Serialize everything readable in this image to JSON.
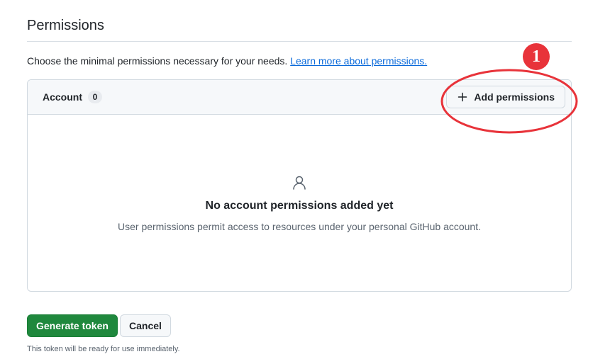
{
  "section": {
    "title": "Permissions",
    "intro_text": "Choose the minimal permissions necessary for your needs.",
    "learn_more_link": "Learn more about permissions."
  },
  "account_panel": {
    "heading": "Account",
    "count": "0",
    "add_button_label": "Add permissions",
    "add_button_icon": "plus-icon",
    "empty_state": {
      "icon": "person-icon",
      "title": "No account permissions added yet",
      "description": "User permissions permit access to resources under your personal GitHub account."
    }
  },
  "annotation": {
    "badge_number": "1",
    "color": "#e8333a"
  },
  "actions": {
    "generate_label": "Generate token",
    "cancel_label": "Cancel",
    "note": "This token will be ready for use immediately."
  },
  "colors": {
    "primary_button": "#1f883d",
    "link": "#0969da",
    "header_bg": "#f6f8fa"
  }
}
